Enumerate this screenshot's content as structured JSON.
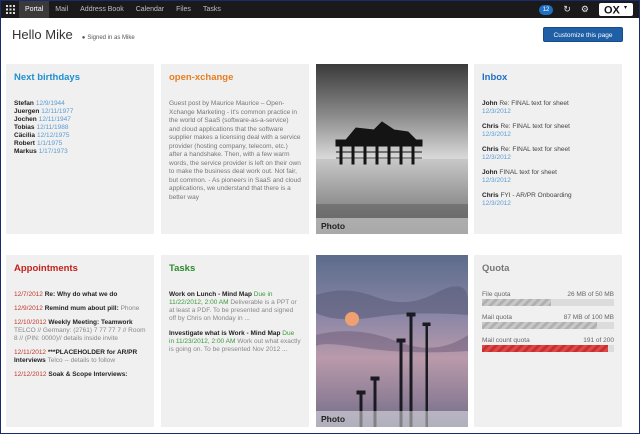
{
  "topbar": {
    "tabs": [
      "Portal",
      "Mail",
      "Address Book",
      "Calendar",
      "Files",
      "Tasks"
    ],
    "active_tab": "Portal",
    "notification_count": "12",
    "logo_text": "OX"
  },
  "header": {
    "greeting": "Hello Mike",
    "signed_in": "Signed in as Mike",
    "customize_label": "Customize this page"
  },
  "birthdays": {
    "title": "Next birthdays",
    "items": [
      {
        "name": "Stefan",
        "date": "12/9/1944"
      },
      {
        "name": "Juergen",
        "date": "12/11/1977"
      },
      {
        "name": "Jochen",
        "date": "12/11/1947"
      },
      {
        "name": "Tobias",
        "date": "12/11/1988"
      },
      {
        "name": "Cäcilia",
        "date": "12/12/1975"
      },
      {
        "name": "Robert",
        "date": "1/1/1975"
      },
      {
        "name": "Markus",
        "date": "1/17/1973"
      }
    ]
  },
  "article": {
    "title": "open-xchange",
    "text": "Guest post by Maurice Maurice – Open-Xchange Marketing - It's common practice in the world of SaaS (software-as-a-service) and cloud applications that the software supplier makes a licensing deal with a service provider (hosting company, telecom, etc.) after a handshake. Then, with a few warm words, the service provider is left on their own to make the business deal work out. Not fair, but common. - As pioneers in SaaS and cloud applications, we understand that there is a better way"
  },
  "photos": {
    "caption_1": "Photo",
    "caption_2": "Photo"
  },
  "inbox": {
    "title": "Inbox",
    "items": [
      {
        "from": "John",
        "subject": "Re: FINAL text for sheet",
        "date": "12/3/2012"
      },
      {
        "from": "Chris",
        "subject": "Re: FINAL text for sheet",
        "date": "12/3/2012"
      },
      {
        "from": "Chris",
        "subject": "Re: FINAL text for sheet",
        "date": "12/3/2012"
      },
      {
        "from": "John",
        "subject": "FINAL text for sheet",
        "date": "12/3/2012"
      },
      {
        "from": "Chris",
        "subject": "FYI - AR/PR Onboarding",
        "date": "12/3/2012"
      }
    ]
  },
  "appointments": {
    "title": "Appointments",
    "items": [
      {
        "date": "12/7/2012",
        "title": "Re: Why do what we do",
        "location": ""
      },
      {
        "date": "12/9/2012",
        "title": "Remind mum about pill:",
        "location": "Phone"
      },
      {
        "date": "12/10/2012",
        "title": "Weekly Meeting: Teamwork",
        "location": "TELCO // Germany: (2761) 7 77 77 7 // Room 8 // (PIN: 0000)// details inside invite"
      },
      {
        "date": "12/11/2012",
        "title": "***PLACEHOLDER for AR/PR Interviews",
        "location": "Telco -- details to follow"
      },
      {
        "date": "12/12/2012",
        "title": "Soak & Scope Interviews:",
        "location": ""
      }
    ]
  },
  "tasks": {
    "title": "Tasks",
    "items": [
      {
        "title": "Work on Lunch - Mind Map",
        "due": "Due in 11/22/2012, 2:00 AM",
        "desc": "Deliverable is a PPT or at least a PDF. To be presented and signed off by Chris on Monday in ..."
      },
      {
        "title": "Investigate what is Work - Mind Map",
        "due": "Due in 11/23/2012, 2:00 AM",
        "desc": "Work out what exactly is going on. To be presented Nov 2012 ..."
      }
    ]
  },
  "quota": {
    "title": "Quota",
    "items": [
      {
        "label": "File quota",
        "value": "26 MB of 50 MB",
        "fraction": 0.52,
        "color": "gray"
      },
      {
        "label": "Mail quota",
        "value": "87 MB of 100 MB",
        "fraction": 0.87,
        "color": "gray"
      },
      {
        "label": "Mail count quota",
        "value": "191 of 200",
        "fraction": 0.955,
        "color": "red"
      }
    ]
  },
  "colors": {
    "birthdays_title": "#1f8fd0",
    "article_title": "#e67e22",
    "inbox_title": "#1f6fc5",
    "appointments_title": "#c0221c",
    "tasks_title": "#2e8a2e",
    "quota_title": "#777777",
    "topbar": "#1a1a1a",
    "customize_button": "#1f5fa6"
  }
}
